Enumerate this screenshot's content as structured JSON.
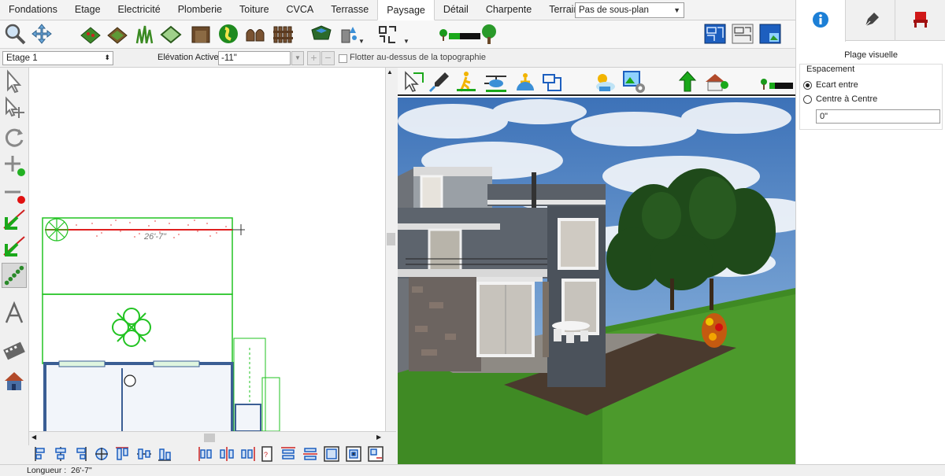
{
  "menu": {
    "tabs": [
      "Fondations",
      "Etage",
      "Electricité",
      "Plomberie",
      "Toiture",
      "CVCA",
      "Terrasse",
      "Paysage",
      "Détail",
      "Charpente",
      "Terrain"
    ],
    "active_tab": "Paysage",
    "subplan_select": "Pas de sous-plan"
  },
  "toolbar2": {
    "floor_select": "Etage 1",
    "elevation_label": "Elévation Active:",
    "elevation_value": "-11\"",
    "float_label": "Flotter au-dessus de la topographie"
  },
  "plan": {
    "dimension_label": "26'-7\""
  },
  "right_panel": {
    "title": "Plage visuelle",
    "spacing_title": "Espacement",
    "option_between": "Ecart entre",
    "option_center": "Centre à Centre",
    "spacing_value": "0\""
  },
  "status": {
    "label": "Longueur :",
    "value": "26'-7\""
  },
  "colors": {
    "accent_green": "#1aa81a",
    "plan_green": "#22c322",
    "wall_blue": "#3b5e94",
    "info_blue": "#1c7fd6"
  }
}
